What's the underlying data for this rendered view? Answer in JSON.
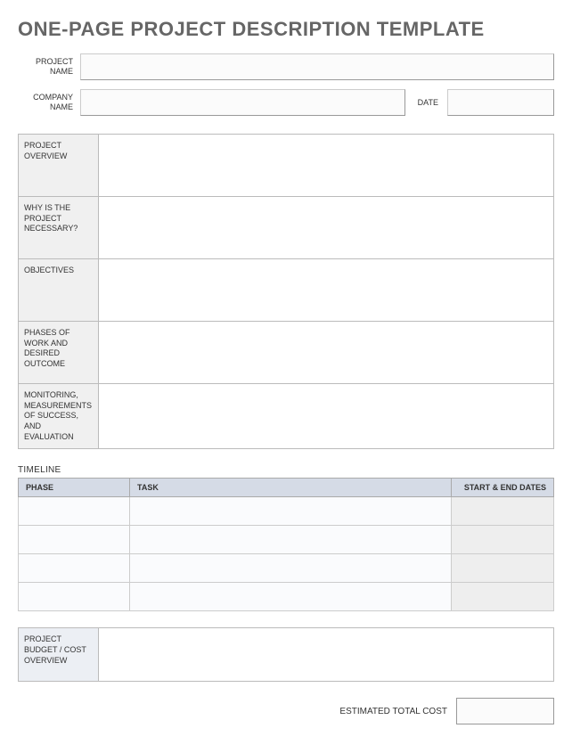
{
  "title": "ONE-PAGE PROJECT DESCRIPTION TEMPLATE",
  "header": {
    "project_name_label": "PROJECT NAME",
    "project_name_value": "",
    "company_name_label": "COMPANY NAME",
    "company_name_value": "",
    "date_label": "DATE",
    "date_value": ""
  },
  "sections": {
    "overview": "PROJECT OVERVIEW",
    "why": "WHY IS THE PROJECT NECESSARY?",
    "objectives": "OBJECTIVES",
    "phases": "PHASES OF WORK AND DESIRED OUTCOME",
    "monitoring": "MONITORING, MEASUREMENTS OF SUCCESS, AND EVALUATION"
  },
  "section_values": {
    "overview": "",
    "why": "",
    "objectives": "",
    "phases": "",
    "monitoring": ""
  },
  "timeline": {
    "heading": "TIMELINE",
    "columns": {
      "phase": "PHASE",
      "task": "TASK",
      "dates": "START & END DATES"
    },
    "rows": [
      {
        "phase": "",
        "task": "",
        "dates": ""
      },
      {
        "phase": "",
        "task": "",
        "dates": ""
      },
      {
        "phase": "",
        "task": "",
        "dates": ""
      },
      {
        "phase": "",
        "task": "",
        "dates": ""
      }
    ]
  },
  "budget": {
    "label": "PROJECT BUDGET / COST OVERVIEW",
    "value": ""
  },
  "total": {
    "label": "ESTIMATED TOTAL COST",
    "value": ""
  }
}
